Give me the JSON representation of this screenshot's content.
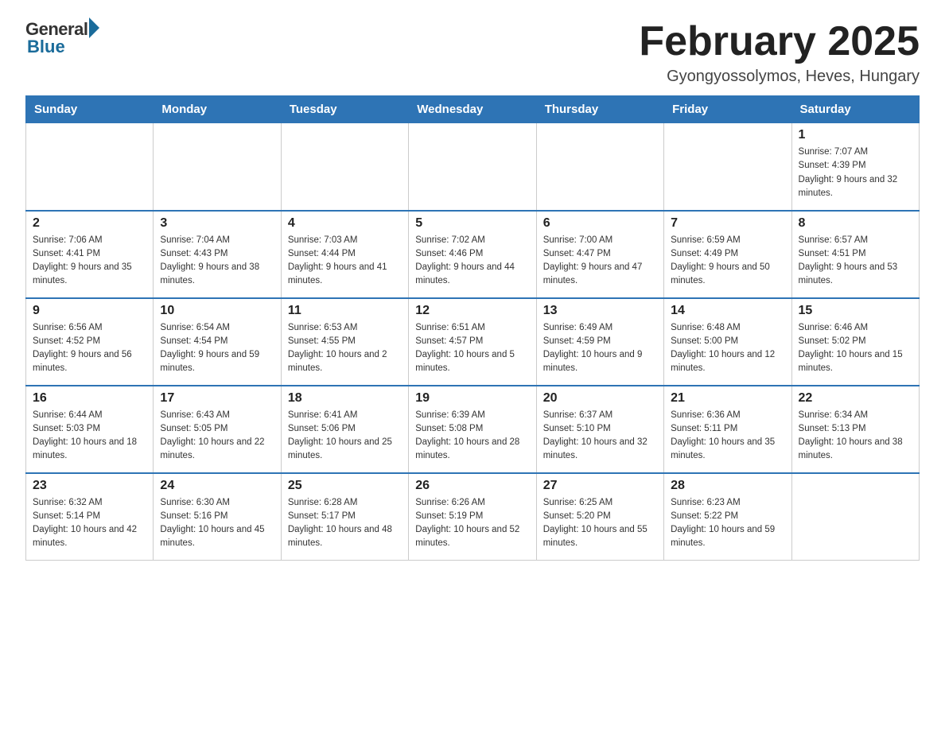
{
  "logo": {
    "general": "General",
    "blue": "Blue"
  },
  "title": "February 2025",
  "location": "Gyongyossolymos, Heves, Hungary",
  "days_of_week": [
    "Sunday",
    "Monday",
    "Tuesday",
    "Wednesday",
    "Thursday",
    "Friday",
    "Saturday"
  ],
  "weeks": [
    [
      {
        "day": "",
        "info": ""
      },
      {
        "day": "",
        "info": ""
      },
      {
        "day": "",
        "info": ""
      },
      {
        "day": "",
        "info": ""
      },
      {
        "day": "",
        "info": ""
      },
      {
        "day": "",
        "info": ""
      },
      {
        "day": "1",
        "info": "Sunrise: 7:07 AM\nSunset: 4:39 PM\nDaylight: 9 hours and 32 minutes."
      }
    ],
    [
      {
        "day": "2",
        "info": "Sunrise: 7:06 AM\nSunset: 4:41 PM\nDaylight: 9 hours and 35 minutes."
      },
      {
        "day": "3",
        "info": "Sunrise: 7:04 AM\nSunset: 4:43 PM\nDaylight: 9 hours and 38 minutes."
      },
      {
        "day": "4",
        "info": "Sunrise: 7:03 AM\nSunset: 4:44 PM\nDaylight: 9 hours and 41 minutes."
      },
      {
        "day": "5",
        "info": "Sunrise: 7:02 AM\nSunset: 4:46 PM\nDaylight: 9 hours and 44 minutes."
      },
      {
        "day": "6",
        "info": "Sunrise: 7:00 AM\nSunset: 4:47 PM\nDaylight: 9 hours and 47 minutes."
      },
      {
        "day": "7",
        "info": "Sunrise: 6:59 AM\nSunset: 4:49 PM\nDaylight: 9 hours and 50 minutes."
      },
      {
        "day": "8",
        "info": "Sunrise: 6:57 AM\nSunset: 4:51 PM\nDaylight: 9 hours and 53 minutes."
      }
    ],
    [
      {
        "day": "9",
        "info": "Sunrise: 6:56 AM\nSunset: 4:52 PM\nDaylight: 9 hours and 56 minutes."
      },
      {
        "day": "10",
        "info": "Sunrise: 6:54 AM\nSunset: 4:54 PM\nDaylight: 9 hours and 59 minutes."
      },
      {
        "day": "11",
        "info": "Sunrise: 6:53 AM\nSunset: 4:55 PM\nDaylight: 10 hours and 2 minutes."
      },
      {
        "day": "12",
        "info": "Sunrise: 6:51 AM\nSunset: 4:57 PM\nDaylight: 10 hours and 5 minutes."
      },
      {
        "day": "13",
        "info": "Sunrise: 6:49 AM\nSunset: 4:59 PM\nDaylight: 10 hours and 9 minutes."
      },
      {
        "day": "14",
        "info": "Sunrise: 6:48 AM\nSunset: 5:00 PM\nDaylight: 10 hours and 12 minutes."
      },
      {
        "day": "15",
        "info": "Sunrise: 6:46 AM\nSunset: 5:02 PM\nDaylight: 10 hours and 15 minutes."
      }
    ],
    [
      {
        "day": "16",
        "info": "Sunrise: 6:44 AM\nSunset: 5:03 PM\nDaylight: 10 hours and 18 minutes."
      },
      {
        "day": "17",
        "info": "Sunrise: 6:43 AM\nSunset: 5:05 PM\nDaylight: 10 hours and 22 minutes."
      },
      {
        "day": "18",
        "info": "Sunrise: 6:41 AM\nSunset: 5:06 PM\nDaylight: 10 hours and 25 minutes."
      },
      {
        "day": "19",
        "info": "Sunrise: 6:39 AM\nSunset: 5:08 PM\nDaylight: 10 hours and 28 minutes."
      },
      {
        "day": "20",
        "info": "Sunrise: 6:37 AM\nSunset: 5:10 PM\nDaylight: 10 hours and 32 minutes."
      },
      {
        "day": "21",
        "info": "Sunrise: 6:36 AM\nSunset: 5:11 PM\nDaylight: 10 hours and 35 minutes."
      },
      {
        "day": "22",
        "info": "Sunrise: 6:34 AM\nSunset: 5:13 PM\nDaylight: 10 hours and 38 minutes."
      }
    ],
    [
      {
        "day": "23",
        "info": "Sunrise: 6:32 AM\nSunset: 5:14 PM\nDaylight: 10 hours and 42 minutes."
      },
      {
        "day": "24",
        "info": "Sunrise: 6:30 AM\nSunset: 5:16 PM\nDaylight: 10 hours and 45 minutes."
      },
      {
        "day": "25",
        "info": "Sunrise: 6:28 AM\nSunset: 5:17 PM\nDaylight: 10 hours and 48 minutes."
      },
      {
        "day": "26",
        "info": "Sunrise: 6:26 AM\nSunset: 5:19 PM\nDaylight: 10 hours and 52 minutes."
      },
      {
        "day": "27",
        "info": "Sunrise: 6:25 AM\nSunset: 5:20 PM\nDaylight: 10 hours and 55 minutes."
      },
      {
        "day": "28",
        "info": "Sunrise: 6:23 AM\nSunset: 5:22 PM\nDaylight: 10 hours and 59 minutes."
      },
      {
        "day": "",
        "info": ""
      }
    ]
  ]
}
